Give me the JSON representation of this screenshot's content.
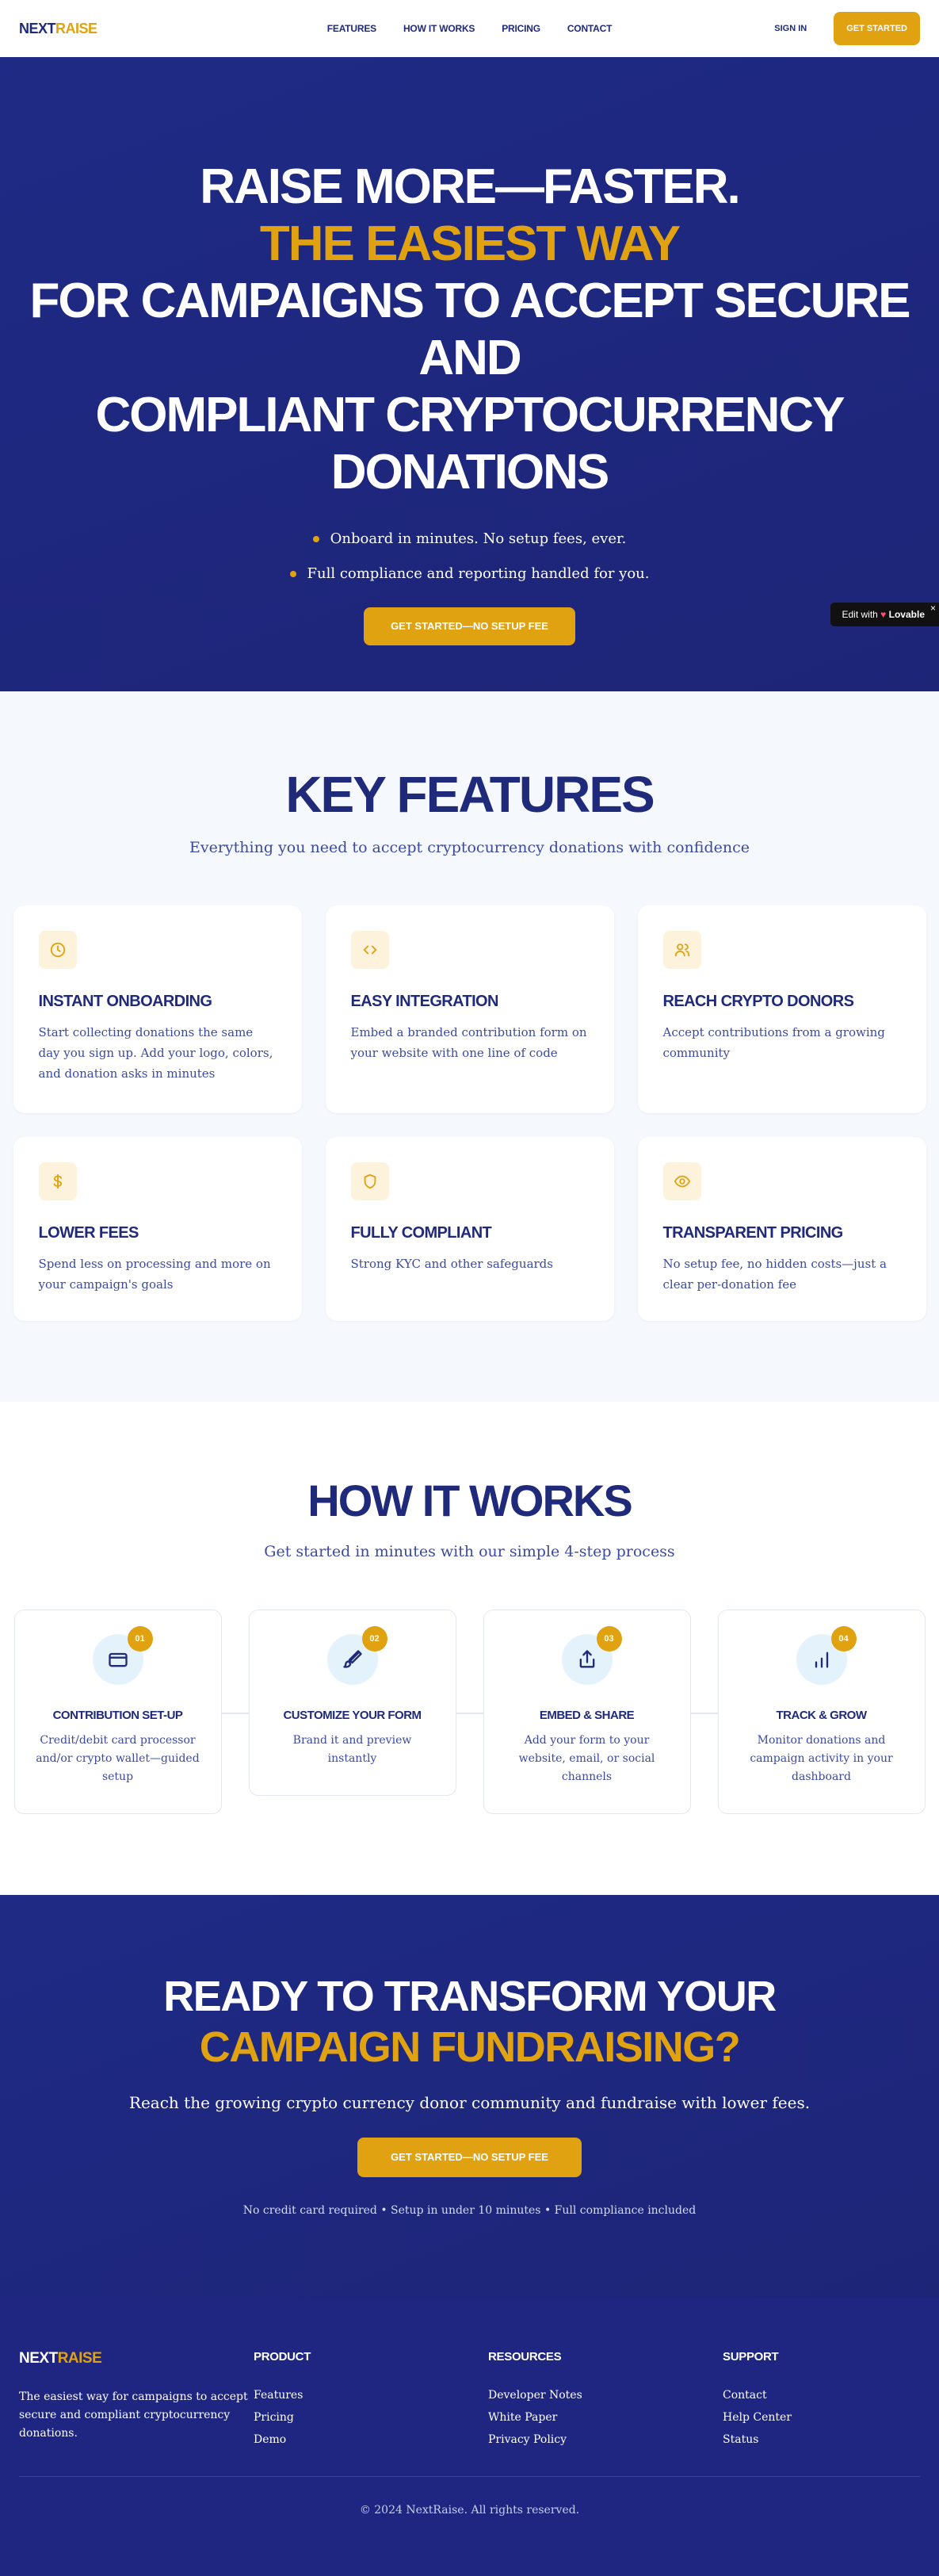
{
  "nav": {
    "logo_a": "NEXT",
    "logo_b": "RAISE",
    "links": [
      "FEATURES",
      "HOW IT WORKS",
      "PRICING",
      "CONTACT"
    ],
    "signin": "SIGN IN",
    "cta": "GET STARTED"
  },
  "hero": {
    "line1": "RAISE MORE—FASTER.",
    "line2": "THE EASIEST WAY",
    "line3": "FOR CAMPAIGNS TO ACCEPT SECURE AND",
    "line4": "COMPLIANT CRYPTOCURRENCY",
    "line5": "DONATIONS",
    "bullets": [
      "Onboard in minutes. No setup fees, ever.",
      "Full compliance and reporting handled for you."
    ],
    "cta": "GET STARTED—NO SETUP FEE"
  },
  "badge": {
    "edit": "Edit with",
    "brand": "Lovable",
    "close": "×"
  },
  "features": {
    "title": "KEY FEATURES",
    "subtitle": "Everything you need to accept cryptocurrency donations with confidence",
    "items": [
      {
        "icon": "clock-icon",
        "title": "INSTANT ONBOARDING",
        "desc": "Start collecting donations the same day you sign up. Add your logo, colors, and donation asks in minutes"
      },
      {
        "icon": "code-icon",
        "title": "EASY INTEGRATION",
        "desc": "Embed a branded contribution form on your website with one line of code"
      },
      {
        "icon": "users-icon",
        "title": "REACH CRYPTO DONORS",
        "desc": "Accept contributions from a growing community"
      },
      {
        "icon": "dollar-icon",
        "title": "LOWER FEES",
        "desc": "Spend less on processing and more on your campaign's goals"
      },
      {
        "icon": "shield-icon",
        "title": "FULLY COMPLIANT",
        "desc": "Strong KYC and other safeguards"
      },
      {
        "icon": "eye-icon",
        "title": "TRANSPARENT PRICING",
        "desc": "No setup fee, no hidden costs—just a clear per-donation fee"
      }
    ]
  },
  "how": {
    "title": "HOW IT WORKS",
    "subtitle": "Get started in minutes with our simple 4-step process",
    "steps": [
      {
        "num": "01",
        "icon": "credit-card-icon",
        "title": "CONTRIBUTION SET-UP",
        "desc": "Credit/debit card processor and/or crypto wallet—guided setup"
      },
      {
        "num": "02",
        "icon": "brush-icon",
        "title": "CUSTOMIZE YOUR FORM",
        "desc": "Brand it and preview instantly"
      },
      {
        "num": "03",
        "icon": "share-icon",
        "title": "EMBED & SHARE",
        "desc": "Add your form to your website, email, or social channels"
      },
      {
        "num": "04",
        "icon": "bar-chart-icon",
        "title": "TRACK & GROW",
        "desc": "Monitor donations and campaign activity in your dashboard"
      }
    ]
  },
  "cta": {
    "line1": "READY TO TRANSFORM YOUR",
    "line2": "CAMPAIGN FUNDRAISING?",
    "subtitle": "Reach the growing crypto currency donor community and fundraise with lower fees.",
    "button": "GET STARTED—NO SETUP FEE",
    "note": "No credit card required • Setup in under 10 minutes • Full compliance included"
  },
  "footer": {
    "logo_a": "NEXT",
    "logo_b": "RAISE",
    "about": "The easiest way for campaigns to accept secure and compliant cryptocurrency donations.",
    "columns": [
      {
        "title": "PRODUCT",
        "links": [
          "Features",
          "Pricing",
          "Demo"
        ]
      },
      {
        "title": "RESOURCES",
        "links": [
          "Developer Notes",
          "White Paper",
          "Privacy Policy"
        ]
      },
      {
        "title": "SUPPORT",
        "links": [
          "Contact",
          "Help Center",
          "Status"
        ]
      }
    ],
    "copyright": "© 2024 NextRaise. All rights reserved."
  },
  "colors": {
    "navy": "#1f2a7a",
    "gold": "#e0a210",
    "hero_bg": "#1e2a85",
    "features_bg": "#f5f8fd"
  }
}
